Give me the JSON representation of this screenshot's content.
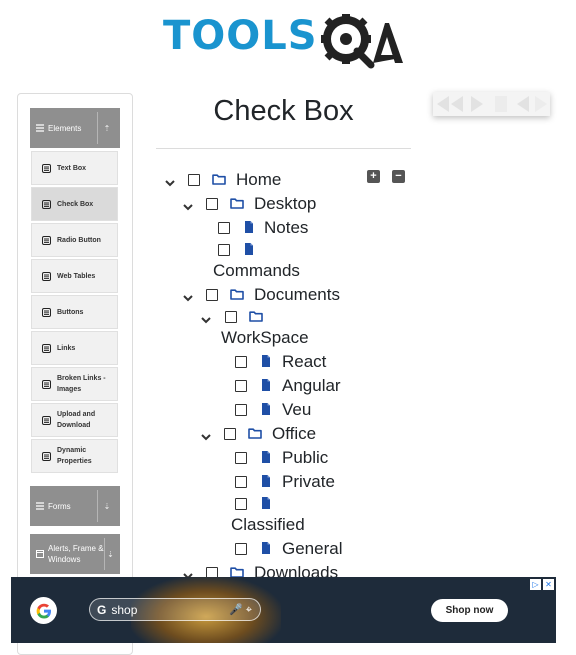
{
  "header": {
    "logo_text": "TOOLS",
    "logo_mark_letter": "A"
  },
  "sidebar": {
    "groups": [
      {
        "label": "Elements",
        "toggle": "expanded"
      },
      {
        "label": "Forms",
        "toggle": "collapsed"
      },
      {
        "label": "Alerts, Frame & Windows",
        "toggle": "collapsed"
      }
    ],
    "items": [
      {
        "label": "Text Box"
      },
      {
        "label": "Check Box",
        "active": true
      },
      {
        "label": "Radio Button"
      },
      {
        "label": "Web Tables"
      },
      {
        "label": "Buttons"
      },
      {
        "label": "Links"
      },
      {
        "label": "Broken Links - Images"
      },
      {
        "label": "Upload and Download"
      },
      {
        "label": "Dynamic Properties"
      }
    ]
  },
  "main": {
    "title": "Check Box",
    "expand_all_symbol": "+",
    "collapse_all_symbol": "−",
    "tree": [
      {
        "label": "Home",
        "type": "folder",
        "expanded": true
      },
      {
        "label": "Desktop",
        "type": "folder",
        "expanded": true
      },
      {
        "label": "Notes",
        "type": "file"
      },
      {
        "label": "Commands",
        "type": "file"
      },
      {
        "label": "Documents",
        "type": "folder",
        "expanded": true
      },
      {
        "label": "WorkSpace",
        "type": "folder",
        "expanded": true
      },
      {
        "label": "React",
        "type": "file"
      },
      {
        "label": "Angular",
        "type": "file"
      },
      {
        "label": "Veu",
        "type": "file"
      },
      {
        "label": "Office",
        "type": "folder",
        "expanded": true
      },
      {
        "label": "Public",
        "type": "file"
      },
      {
        "label": "Private",
        "type": "file"
      },
      {
        "label": "Classified",
        "type": "file"
      },
      {
        "label": "General",
        "type": "file"
      },
      {
        "label": "Downloads",
        "type": "folder",
        "expanded": true
      }
    ]
  },
  "ad": {
    "search_text": "shop",
    "button_label": "Shop now",
    "badge_info": "▷",
    "badge_close": "✕"
  },
  "colors": {
    "brand_blue": "#1a94cf",
    "sidebar_header": "#8f8f8f",
    "icon_blue": "#1f4fa6",
    "text": "#212529"
  }
}
